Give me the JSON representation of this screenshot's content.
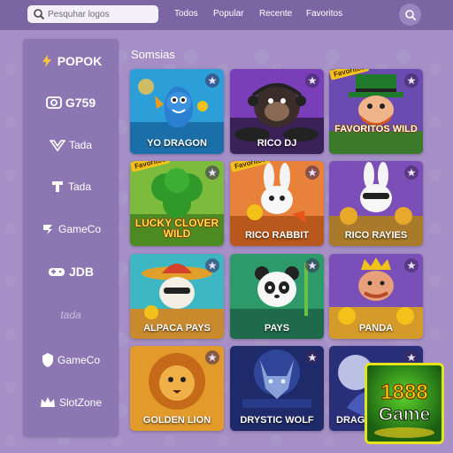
{
  "search": {
    "placeholder": "Pesquhar logos"
  },
  "nav": {
    "all": "Todos",
    "popular": "Popular",
    "recent": "Recente",
    "favorites": "Favoritos"
  },
  "sidebar": {
    "items": [
      {
        "label": "POPOK"
      },
      {
        "label": "G759"
      },
      {
        "label": "Tada"
      },
      {
        "label": "Tada"
      },
      {
        "label": "GameCo"
      },
      {
        "label": "JDB"
      },
      {
        "label": "tada"
      },
      {
        "label": "GameCo"
      },
      {
        "label": "SlotZone"
      }
    ]
  },
  "section": {
    "title": "Somsias"
  },
  "games": [
    {
      "title": "YO DRAGON",
      "favorite_tag": "",
      "art_text": ""
    },
    {
      "title": "RICO DJ",
      "favorite_tag": "",
      "art_text": ""
    },
    {
      "title": "",
      "favorite_tag": "Favoritos",
      "art_text": "FAVORITOS WILD"
    },
    {
      "title": "",
      "favorite_tag": "Favoritos",
      "art_text": "LUCKY CLOVER WILD"
    },
    {
      "title": "RICO RABBIT",
      "favorite_tag": "Favoritos",
      "art_text": ""
    },
    {
      "title": "RICO RAYIES",
      "favorite_tag": "",
      "art_text": ""
    },
    {
      "title": "ALPACA PAYS",
      "favorite_tag": "",
      "art_text": ""
    },
    {
      "title": "PAYS",
      "favorite_tag": "",
      "art_text": ""
    },
    {
      "title": "PANDA",
      "favorite_tag": "",
      "art_text": ""
    },
    {
      "title": "GOLDEN LION",
      "favorite_tag": "",
      "art_text": ""
    },
    {
      "title": "DRYSTIC WOLF",
      "favorite_tag": "",
      "art_text": ""
    },
    {
      "title": "DRAGO",
      "favorite_tag": "",
      "art_text": ""
    }
  ],
  "watermark": {
    "line1": "1888",
    "line2": "Game"
  },
  "colors": {
    "background": "#a58fc6",
    "topbar": "#7b66a3",
    "sidebar": "#8c77b3",
    "favorite_tag": "#f2c21a"
  }
}
